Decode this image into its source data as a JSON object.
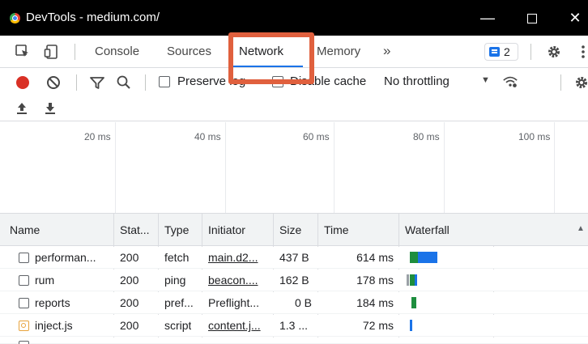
{
  "window": {
    "title": "DevTools - medium.com/"
  },
  "tabs": [
    {
      "label": "Console"
    },
    {
      "label": "Sources"
    },
    {
      "label": "Network"
    },
    {
      "label": "Memory"
    }
  ],
  "more_tabs_symbol": "»",
  "issues_count": "2",
  "toolbar": {
    "preserve_log": "Preserve log",
    "disable_cache": "Disable cache",
    "throttling": "No throttling"
  },
  "overview_ticks": [
    "20 ms",
    "40 ms",
    "60 ms",
    "80 ms",
    "100 ms"
  ],
  "table": {
    "columns": [
      "Name",
      "Stat...",
      "Type",
      "Initiator",
      "Size",
      "Time",
      "Waterfall"
    ],
    "rows": [
      {
        "name": "performan...",
        "status": "200",
        "type": "fetch",
        "initiator": "main.d2...",
        "size": "437 B",
        "time": "614 ms"
      },
      {
        "name": "rum",
        "status": "200",
        "type": "ping",
        "initiator": "beacon....",
        "size": "162 B",
        "time": "178 ms"
      },
      {
        "name": "reports",
        "status": "200",
        "type": "pref...",
        "initiator": "Preflight...",
        "size": "0 B",
        "time": "184 ms"
      },
      {
        "name": "inject.js",
        "status": "200",
        "type": "script",
        "initiator": "content.j...",
        "size": "1.3 ...",
        "time": "72 ms"
      }
    ]
  },
  "colors": {
    "accent": "#1a73e8",
    "highlight": "#e0603e",
    "record": "#d93025",
    "waterfall_green": "#1e8e3e",
    "waterfall_blue": "#1a73e8"
  }
}
